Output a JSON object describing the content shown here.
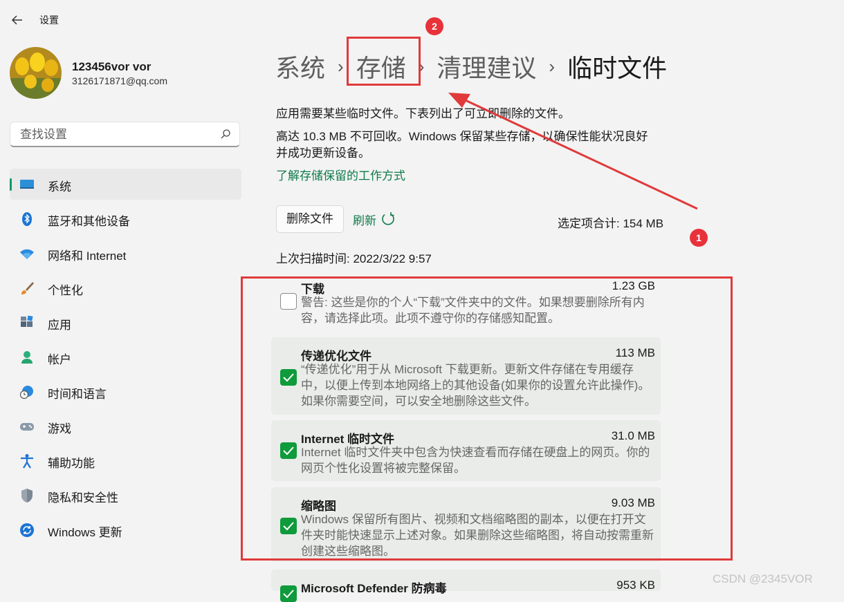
{
  "app": {
    "title": "设置"
  },
  "user": {
    "name": "123456vor vor",
    "email": "3126171871@qq.com"
  },
  "search": {
    "placeholder": "查找设置"
  },
  "nav": [
    {
      "label": "系统",
      "icon": "system-icon",
      "active": true
    },
    {
      "label": "蓝牙和其他设备",
      "icon": "bluetooth-icon"
    },
    {
      "label": "网络和 Internet",
      "icon": "wifi-icon"
    },
    {
      "label": "个性化",
      "icon": "brush-icon"
    },
    {
      "label": "应用",
      "icon": "apps-icon"
    },
    {
      "label": "帐户",
      "icon": "account-icon"
    },
    {
      "label": "时间和语言",
      "icon": "globe-clock-icon"
    },
    {
      "label": "游戏",
      "icon": "gamepad-icon"
    },
    {
      "label": "辅助功能",
      "icon": "accessibility-icon"
    },
    {
      "label": "隐私和安全性",
      "icon": "shield-icon"
    },
    {
      "label": "Windows 更新",
      "icon": "update-icon"
    }
  ],
  "breadcrumb": [
    "系统",
    "存储",
    "清理建议",
    "临时文件"
  ],
  "intro": {
    "line1": "应用需要某些临时文件。下表列出了可立即删除的文件。",
    "line2": "高达 10.3 MB 不可回收。Windows 保留某些存储，以确保性能状况良好",
    "line3": "并成功更新设备。",
    "link": "了解存储保留的工作方式"
  },
  "actions": {
    "delete": "删除文件",
    "refresh": "刷新",
    "total": "选定项合计: 154 MB"
  },
  "scan_time": "上次扫描时间: 2022/3/22 9:57",
  "items": [
    {
      "title": "下载",
      "size": "1.23 GB",
      "checked": false,
      "desc": "警告: 这些是你的个人“下载”文件夹中的文件。如果想要删除所有内容，请选择此项。此项不遵守你的存储感知配置。"
    },
    {
      "title": "传递优化文件",
      "size": "113 MB",
      "checked": true,
      "desc": "“传递优化”用于从 Microsoft 下载更新。更新文件存储在专用缓存中，以便上传到本地网络上的其他设备(如果你的设置允许此操作)。如果你需要空间，可以安全地删除这些文件。"
    },
    {
      "title": "Internet 临时文件",
      "size": "31.0 MB",
      "checked": true,
      "desc": "Internet 临时文件夹中包含为快速查看而存储在硬盘上的网页。你的网页个性化设置将被完整保留。"
    },
    {
      "title": "缩略图",
      "size": "9.03 MB",
      "checked": true,
      "desc": "Windows 保留所有图片、视频和文档缩略图的副本，以便在打开文件夹时能快速显示上述对象。如果删除这些缩略图，将自动按需重新创建这些缩略图。"
    },
    {
      "title": "Microsoft Defender 防病毒",
      "size": "953 KB",
      "checked": true,
      "desc": ""
    }
  ],
  "annotations": {
    "badge1": "1",
    "badge2": "2",
    "color": "#e03a3a"
  },
  "watermark": "CSDN @2345VOR"
}
